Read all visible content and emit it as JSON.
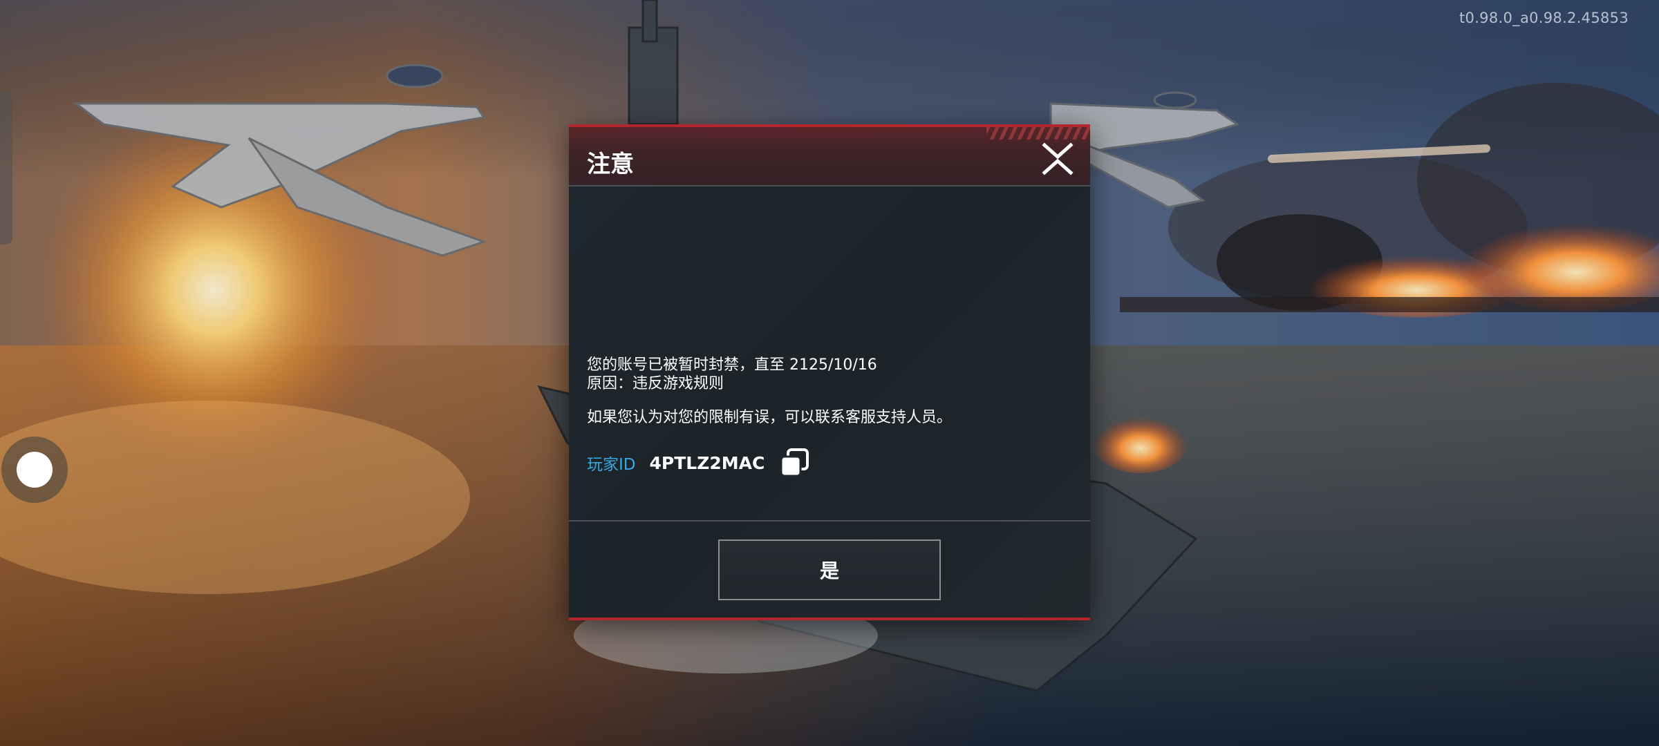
{
  "app": {
    "version": "t0.98.0_a0.98.2.45853"
  },
  "dialog": {
    "title": "注意",
    "ban_message": "您的账号已被暂时封禁，直至 2125/10/16",
    "reason": "原因：违反游戏规则",
    "appeal_hint": "如果您认为对您的限制有误，可以联系客服支持人员。",
    "player_id_label": "玩家ID",
    "player_id": "4PTLZ2MAC",
    "confirm_label": "是",
    "icons": {
      "close": "close-icon",
      "copy": "copy-icon"
    }
  },
  "colors": {
    "accent_red": "#b3262d",
    "player_id_label": "#36a9e0"
  }
}
